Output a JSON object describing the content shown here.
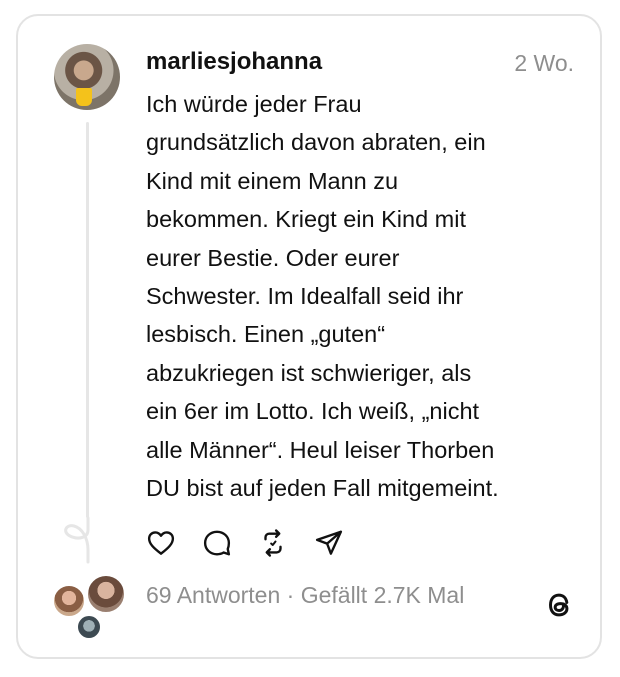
{
  "post": {
    "username": "marliesjohanna",
    "timestamp": "2 Wo.",
    "text": "Ich würde jeder Frau\ngrundsätzlich davon abraten, ein\nKind mit einem Mann zu\nbekommen. Kriegt ein Kind mit\neurer Bestie. Oder eurer\nSchwester. Im Idealfall seid ihr\nlesbisch. Einen „guten“\nabzukriegen ist schwieriger, als\nein 6er im Lotto. Ich weiß, „nicht\nalle Männer“. Heul leiser Thorben\nDU bist auf jeden Fall mitgemeint."
  },
  "actions": {
    "like_icon": "heart-icon",
    "reply_icon": "comment-icon",
    "repost_icon": "repost-icon",
    "share_icon": "send-icon"
  },
  "stats": {
    "text": "69 Antworten · Gefällt 2.7K Mal"
  },
  "branding": {
    "logo_icon": "threads-logo-icon"
  },
  "colors": {
    "text": "#111111",
    "muted": "#8e8e8e",
    "border": "#e3e3e3"
  }
}
